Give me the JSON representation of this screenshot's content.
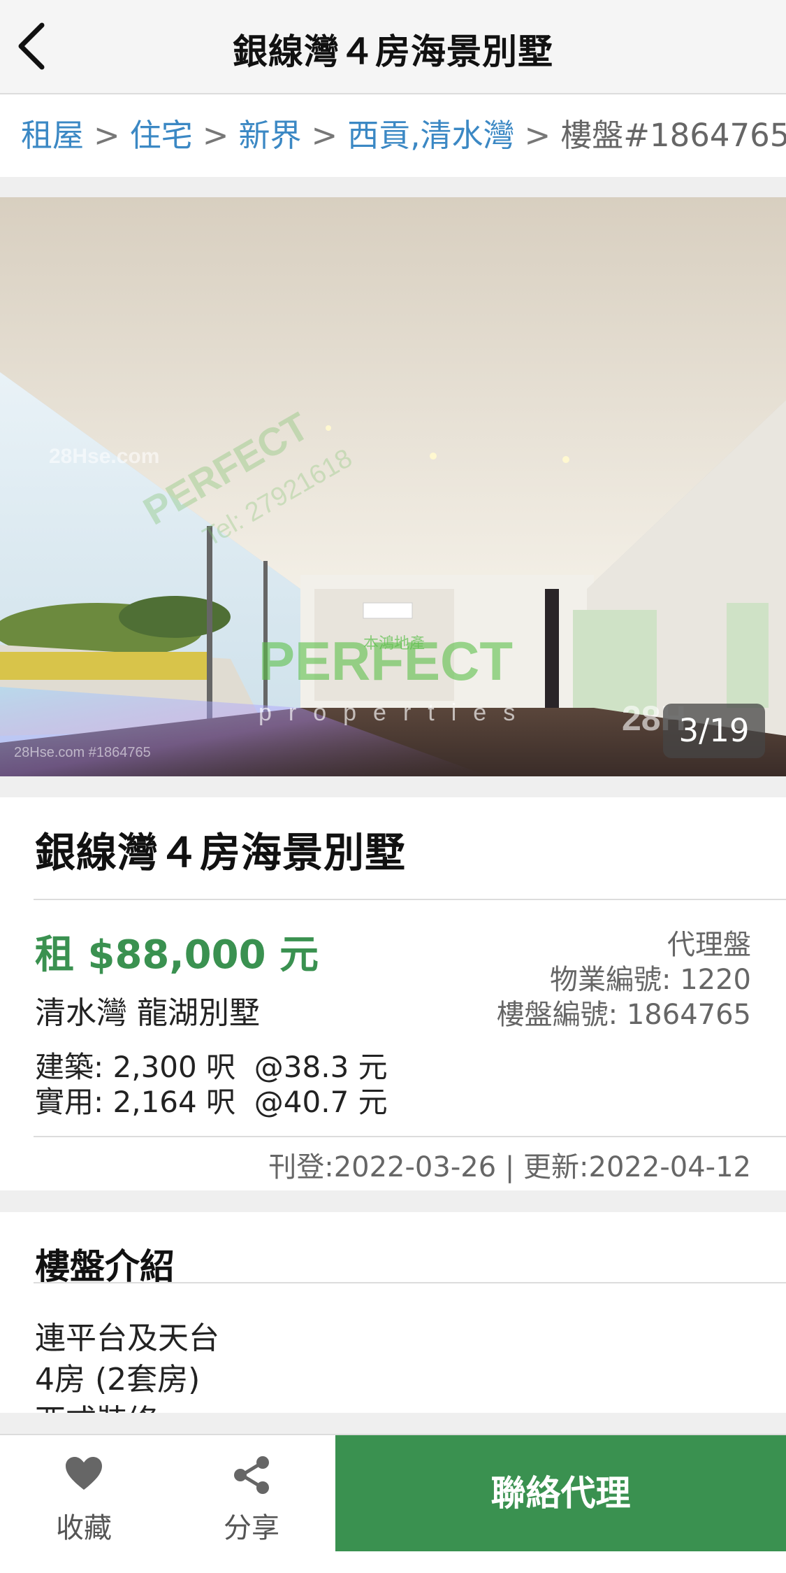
{
  "header": {
    "title": "銀線灣４房海景別墅",
    "back_icon": "chevron-left-icon"
  },
  "breadcrumb": {
    "items": [
      "租屋",
      "住宅",
      "新界",
      "西貢,清水灣"
    ],
    "separator": ">",
    "current": "樓盤#1864765"
  },
  "photo": {
    "counter": "3/19",
    "watermark_brand": "PERFECT properties 本鴻地產",
    "watermark_tel": "Tel: 27921618",
    "watermark_site": "28Hse.com"
  },
  "listing": {
    "title": "銀線灣４房海景別墅",
    "price": "租 $88,000 元",
    "estate": "清水灣 龍湖別墅",
    "gross_area": "建築: 2,300 呎  @38.3 元",
    "saleable_area": "實用: 2,164 呎  @40.7 元",
    "agent_type": "代理盤",
    "property_no": "物業編號: 1220",
    "listing_no": "樓盤編號: 1864765",
    "dates": "刊登:2022-03-26 | 更新:2022-04-12"
  },
  "description": {
    "heading": "樓盤介紹",
    "lines": [
      "連平台及天台",
      "4房 (2套房)",
      "西式裝修"
    ]
  },
  "bottom_bar": {
    "favorite_label": "收藏",
    "favorite_icon": "heart-icon",
    "share_label": "分享",
    "share_icon": "share-icon",
    "contact_label": "聯絡代理"
  },
  "colors": {
    "accent_green": "#3a9150",
    "link_blue": "#3b88c4"
  }
}
